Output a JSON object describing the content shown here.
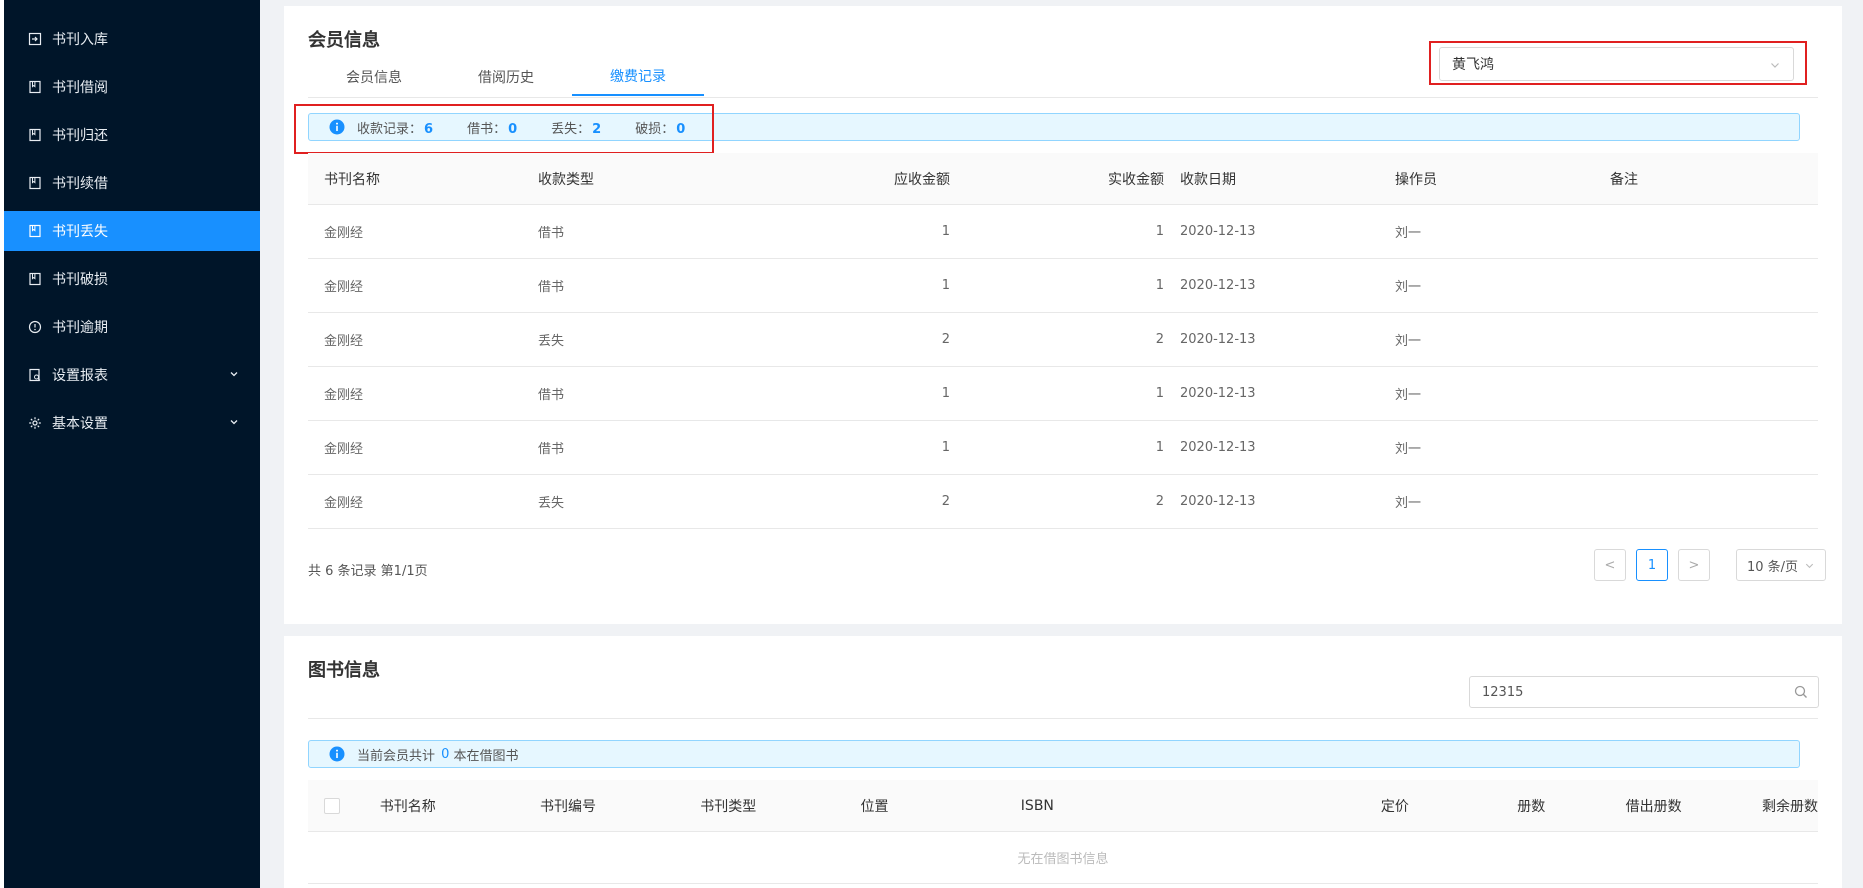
{
  "sidebar": {
    "items": [
      {
        "label": "书刊入库",
        "icon": "book-in-icon",
        "active": false
      },
      {
        "label": "书刊借阅",
        "icon": "book-icon",
        "active": false
      },
      {
        "label": "书刊归还",
        "icon": "book-icon",
        "active": false
      },
      {
        "label": "书刊续借",
        "icon": "book-icon",
        "active": false
      },
      {
        "label": "书刊丢失",
        "icon": "book-icon",
        "active": true
      },
      {
        "label": "书刊破损",
        "icon": "book-icon",
        "active": false
      },
      {
        "label": "书刊逾期",
        "icon": "clock-icon",
        "active": false
      },
      {
        "label": "设置报表",
        "icon": "report-icon",
        "active": false,
        "expandable": true
      },
      {
        "label": "基本设置",
        "icon": "gear-icon",
        "active": false,
        "expandable": true
      }
    ]
  },
  "member_card": {
    "title": "会员信息",
    "tabs": [
      {
        "label": "会员信息",
        "active": false
      },
      {
        "label": "借阅历史",
        "active": false
      },
      {
        "label": "缴费记录",
        "active": true
      }
    ],
    "member_select": {
      "value": "黄飞鸿"
    },
    "summary": {
      "records_label": "收款记录：",
      "records_value": "6",
      "borrow_label": "借书：",
      "borrow_value": "0",
      "lost_label": "丢失：",
      "lost_value": "2",
      "damage_label": "破损：",
      "damage_value": "0"
    },
    "table": {
      "headers": [
        "书刊名称",
        "收款类型",
        "应收金额",
        "实收金额",
        "收款日期",
        "操作员",
        "备注"
      ],
      "rows": [
        [
          "金刚经",
          "借书",
          "1",
          "1",
          "2020-12-13",
          "刘一",
          ""
        ],
        [
          "金刚经",
          "借书",
          "1",
          "1",
          "2020-12-13",
          "刘一",
          ""
        ],
        [
          "金刚经",
          "丢失",
          "2",
          "2",
          "2020-12-13",
          "刘一",
          ""
        ],
        [
          "金刚经",
          "借书",
          "1",
          "1",
          "2020-12-13",
          "刘一",
          ""
        ],
        [
          "金刚经",
          "借书",
          "1",
          "1",
          "2020-12-13",
          "刘一",
          ""
        ],
        [
          "金刚经",
          "丢失",
          "2",
          "2",
          "2020-12-13",
          "刘一",
          ""
        ]
      ]
    },
    "record_summary": "共 6 条记录 第1/1页",
    "pagination": {
      "prev": "<",
      "current": "1",
      "next": ">",
      "page_size": "10 条/页"
    }
  },
  "book_card": {
    "title": "图书信息",
    "search": {
      "value": "12315"
    },
    "alert": {
      "prefix": "当前会员共计 ",
      "count": "0",
      "suffix": " 本在借图书"
    },
    "table": {
      "headers": [
        "书刊名称",
        "书刊编号",
        "书刊类型",
        "位置",
        "ISBN",
        "定价",
        "册数",
        "借出册数",
        "剩余册数"
      ],
      "empty_text": "无在借图书信息"
    }
  },
  "colors": {
    "sidebar_bg": "#001529",
    "accent": "#1890ff",
    "highlight": "#e02020"
  }
}
